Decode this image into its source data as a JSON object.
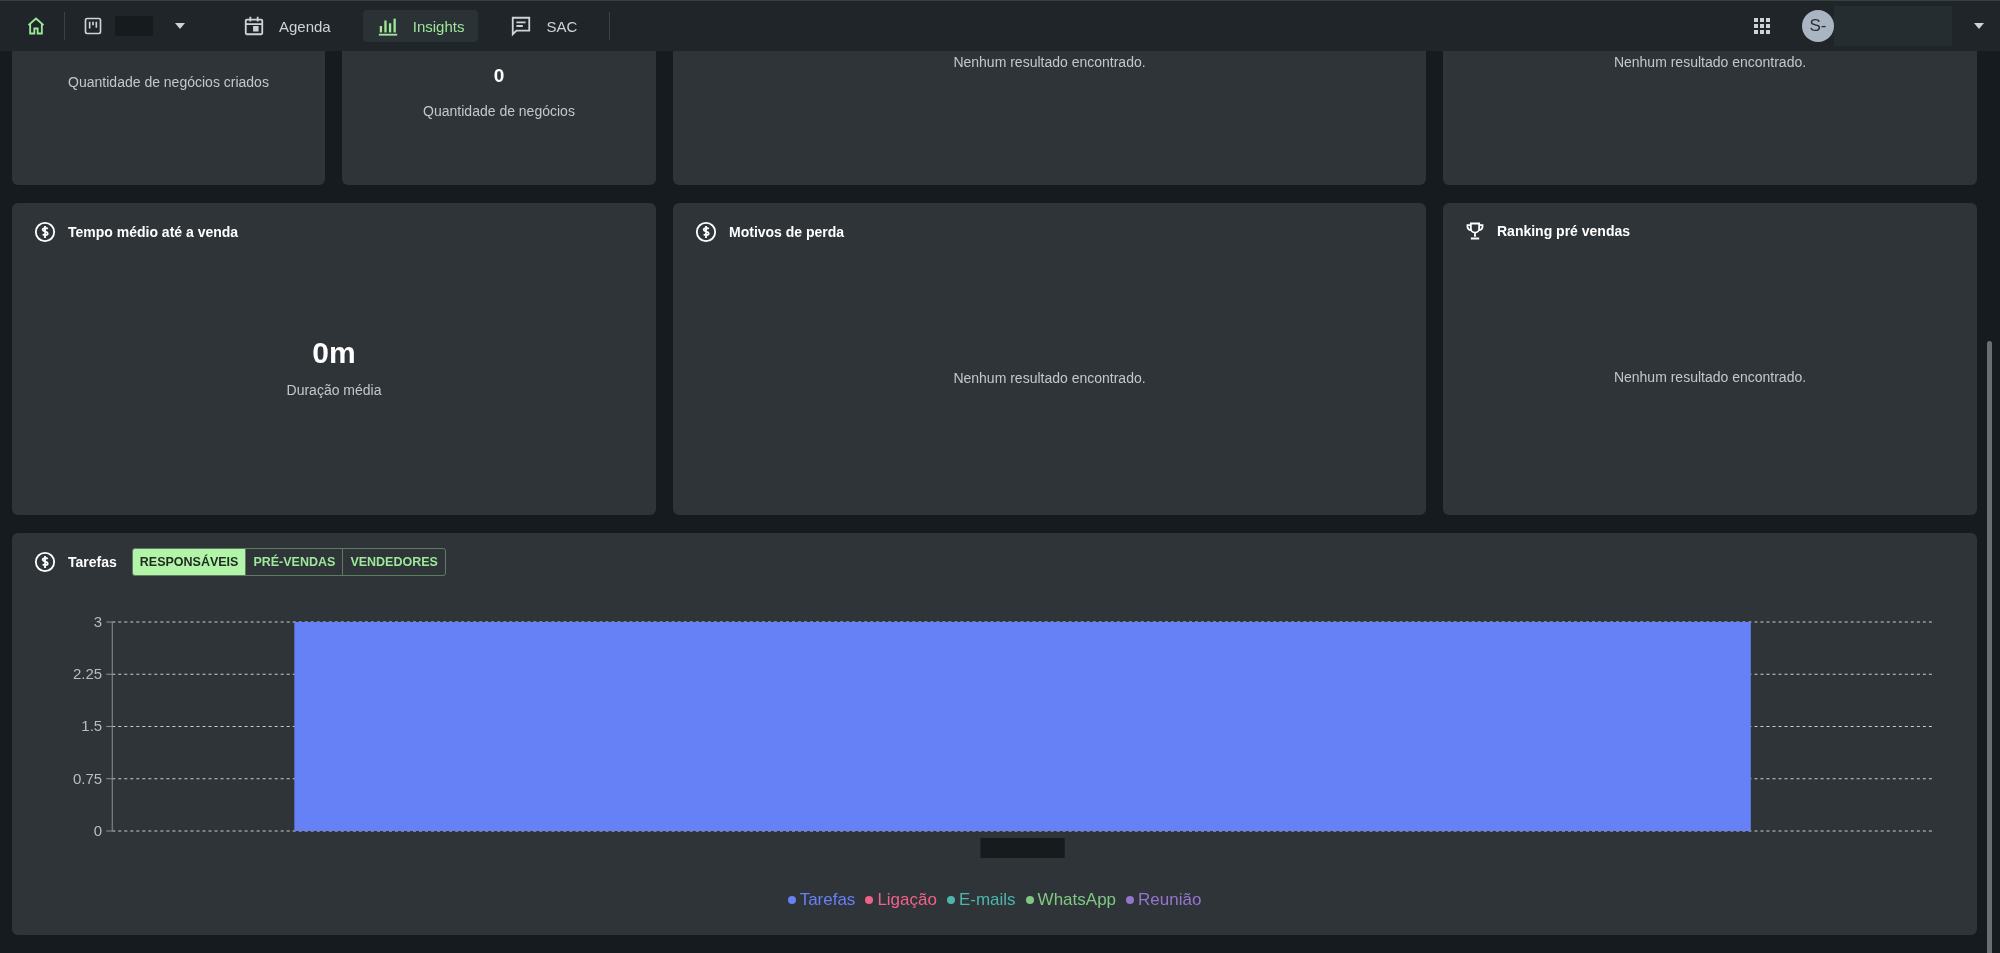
{
  "nav": {
    "tabs": [
      {
        "label": "Agenda",
        "selected": false
      },
      {
        "label": "Insights",
        "selected": true
      },
      {
        "label": "SAC",
        "selected": false
      }
    ],
    "avatar": "S-"
  },
  "top_row": [
    {
      "kind": "metric",
      "caption": "Quantidade de negócios criados"
    },
    {
      "kind": "metric",
      "value": "0",
      "caption": "Quantidade de negócios"
    },
    {
      "kind": "empty",
      "message": "Nenhum resultado encontrado."
    },
    {
      "kind": "empty",
      "message": "Nenhum resultado encontrado."
    }
  ],
  "panels": [
    {
      "title": "Tempo médio até a venda",
      "kind": "metric",
      "value": "0m",
      "caption": "Duração média"
    },
    {
      "title": "Motivos de perda",
      "kind": "empty",
      "message": "Nenhum resultado encontrado."
    },
    {
      "title": "Ranking pré vendas",
      "kind": "empty",
      "message": "Nenhum resultado encontrado."
    }
  ],
  "tarefas": {
    "title": "Tarefas",
    "toggles": [
      {
        "label": "RESPONSÁVEIS",
        "selected": true
      },
      {
        "label": "PRÉ-VENDAS",
        "selected": false
      },
      {
        "label": "VENDEDORES",
        "selected": false
      }
    ],
    "chart_data": {
      "type": "bar",
      "stacked": true,
      "grid": true,
      "ylim": [
        0,
        3
      ],
      "yticks": [
        0,
        0.75,
        1.5,
        2.25,
        3
      ],
      "series": [
        {
          "name": "Tarefas",
          "color": "#6680f5",
          "values": [
            3
          ]
        },
        {
          "name": "Ligação",
          "color": "#f0628a",
          "values": [
            0
          ]
        },
        {
          "name": "E-mails",
          "color": "#4db6ac",
          "values": [
            0
          ]
        },
        {
          "name": "WhatsApp",
          "color": "#81c784",
          "values": [
            0
          ]
        },
        {
          "name": "Reunião",
          "color": "#9575cd",
          "values": [
            0
          ]
        }
      ]
    }
  }
}
